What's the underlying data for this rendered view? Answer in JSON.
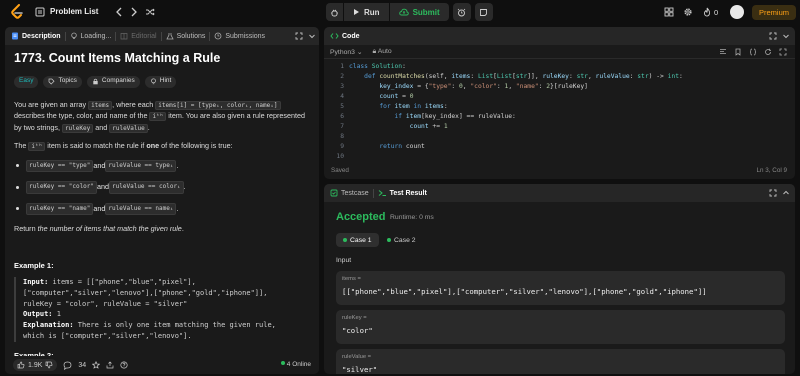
{
  "nav": {
    "problem_list": "Problem List",
    "run": "Run",
    "submit": "Submit",
    "streak": "0",
    "premium": "Premium"
  },
  "left_tabs": {
    "description": "Description",
    "loading": "Loading...",
    "editorial": "Editorial",
    "solutions": "Solutions",
    "submissions": "Submissions"
  },
  "problem": {
    "title": "1773. Count Items Matching a Rule",
    "difficulty": "Easy",
    "topics": "Topics",
    "companies": "Companies",
    "hint": "Hint",
    "p1_a": "You are given an array ",
    "p1_items": "items",
    "p1_b": ", where each ",
    "p1_code": "items[i] = [typeᵢ, colorᵢ, nameᵢ]",
    "p1_c": " describes the type, color, and name of the ",
    "p1_ith": "iᵗʰ",
    "p1_d": " item. You are also given a rule represented by two strings, ",
    "p1_rk": "ruleKey",
    "p1_and": " and ",
    "p1_rv": "ruleValue",
    "p1_end": ".",
    "p2_a": "The ",
    "p2_ith": "iᵗʰ",
    "p2_b": " item is said to match the rule if ",
    "p2_one": "one",
    "p2_c": " of the following is true:",
    "b1_code1": "ruleKey == \"type\"",
    "b1_code2": "ruleValue == typeᵢ",
    "b2_code1": "ruleKey == \"color\"",
    "b2_code2": "ruleValue == colorᵢ",
    "b3_code1": "ruleKey == \"name\"",
    "b3_code2": "ruleValue == nameᵢ",
    "and_word": " and ",
    "period": ".",
    "return_a": "Return ",
    "return_em": "the number of items that match the given rule",
    "return_end": ".",
    "example1": "Example 1:",
    "ex_input_lbl": "Input:",
    "ex_input_1": " items = [[\"phone\",\"blue\",\"pixel\"],",
    "ex_input_2": "[\"computer\",\"silver\",\"lenovo\"],[\"phone\",\"gold\",\"iphone\"]],",
    "ex_input_3": "ruleKey = \"color\", ruleValue = \"silver\"",
    "ex_output_lbl": "Output:",
    "ex_output": " 1",
    "ex_expl_lbl": "Explanation:",
    "ex_expl_1": " There is only one item matching the given rule,",
    "ex_expl_2": "which is [\"computer\",\"silver\",\"lenovo\"].",
    "example2": "Example 2:"
  },
  "footer": {
    "likes": "1.9K",
    "comments": "34",
    "online": "4 Online"
  },
  "code": {
    "tab": "Code",
    "language": "Python3",
    "auto": "Auto",
    "lines": [
      "1",
      "2",
      "3",
      "4",
      "5",
      "6",
      "7",
      "8",
      "9",
      "10"
    ],
    "saved": "Saved",
    "cursor": "Ln 3, Col 9"
  },
  "result": {
    "testcase_tab": "Testcase",
    "result_tab": "Test Result",
    "status": "Accepted",
    "runtime": "Runtime: 0 ms",
    "case1": "Case 1",
    "case2": "Case 2",
    "input_label": "Input",
    "items_key": "items =",
    "items_val": "[[\"phone\",\"blue\",\"pixel\"],[\"computer\",\"silver\",\"lenovo\"],[\"phone\",\"gold\",\"iphone\"]]",
    "rulekey_key": "ruleKey =",
    "rulekey_val": "\"color\"",
    "rulevalue_key": "ruleValue =",
    "rulevalue_val": "\"silver\""
  },
  "colors": {
    "accent_green": "#2cbb5d",
    "premium": "#ffa116",
    "easy": "#1cb8b8"
  }
}
